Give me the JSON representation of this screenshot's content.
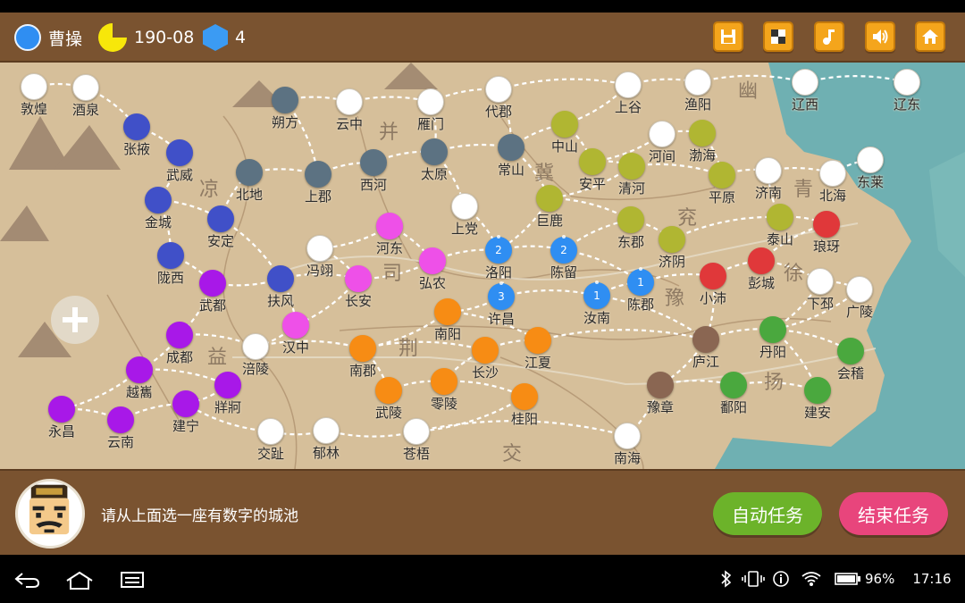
{
  "player": {
    "name": "曹操",
    "date": "190-08",
    "count": "4",
    "color": "#2f8ef2"
  },
  "toolbar": {
    "buttons": [
      {
        "name": "save-button",
        "icon": "floppy-icon"
      },
      {
        "name": "checker-button",
        "icon": "checkerboard-icon"
      },
      {
        "name": "music-button",
        "icon": "music-note-icon"
      },
      {
        "name": "sound-button",
        "icon": "speaker-icon"
      },
      {
        "name": "home-button",
        "icon": "home-icon"
      }
    ]
  },
  "regions": [
    "幽",
    "并",
    "冀",
    "青",
    "凉",
    "兖",
    "司",
    "徐",
    "豫",
    "益",
    "荆",
    "扬",
    "交"
  ],
  "cities": [
    {
      "name": "敦煌",
      "color": "#ffffff",
      "num": ""
    },
    {
      "name": "酒泉",
      "color": "#ffffff",
      "num": ""
    },
    {
      "name": "张掖",
      "color": "#4050c8",
      "num": ""
    },
    {
      "name": "武威",
      "color": "#4050c8",
      "num": ""
    },
    {
      "name": "金城",
      "color": "#4050c8",
      "num": ""
    },
    {
      "name": "安定",
      "color": "#4050c8",
      "num": ""
    },
    {
      "name": "陇西",
      "color": "#4050c8",
      "num": ""
    },
    {
      "name": "北地",
      "color": "#5c7282",
      "num": ""
    },
    {
      "name": "朔方",
      "color": "#5c7282",
      "num": ""
    },
    {
      "name": "云中",
      "color": "#ffffff",
      "num": ""
    },
    {
      "name": "雁门",
      "color": "#ffffff",
      "num": ""
    },
    {
      "name": "代郡",
      "color": "#ffffff",
      "num": ""
    },
    {
      "name": "上谷",
      "color": "#ffffff",
      "num": ""
    },
    {
      "name": "渔阳",
      "color": "#ffffff",
      "num": ""
    },
    {
      "name": "辽西",
      "color": "#ffffff",
      "num": ""
    },
    {
      "name": "辽东",
      "color": "#ffffff",
      "num": ""
    },
    {
      "name": "上郡",
      "color": "#5c7282",
      "num": ""
    },
    {
      "name": "西河",
      "color": "#5c7282",
      "num": ""
    },
    {
      "name": "太原",
      "color": "#5c7282",
      "num": ""
    },
    {
      "name": "常山",
      "color": "#5c7282",
      "num": ""
    },
    {
      "name": "中山",
      "color": "#b0b632",
      "num": ""
    },
    {
      "name": "河间",
      "color": "#ffffff",
      "num": ""
    },
    {
      "name": "渤海",
      "color": "#b0b632",
      "num": ""
    },
    {
      "name": "安平",
      "color": "#b0b632",
      "num": ""
    },
    {
      "name": "清河",
      "color": "#b0b632",
      "num": ""
    },
    {
      "name": "平原",
      "color": "#b0b632",
      "num": ""
    },
    {
      "name": "济南",
      "color": "#ffffff",
      "num": ""
    },
    {
      "name": "北海",
      "color": "#ffffff",
      "num": ""
    },
    {
      "name": "东莱",
      "color": "#ffffff",
      "num": ""
    },
    {
      "name": "巨鹿",
      "color": "#b0b632",
      "num": ""
    },
    {
      "name": "上党",
      "color": "#ffffff",
      "num": ""
    },
    {
      "name": "东郡",
      "color": "#b0b632",
      "num": ""
    },
    {
      "name": "济阴",
      "color": "#b0b632",
      "num": ""
    },
    {
      "name": "泰山",
      "color": "#b0b632",
      "num": ""
    },
    {
      "name": "琅玡",
      "color": "#e0383a",
      "num": ""
    },
    {
      "name": "河东",
      "color": "#ee50e8",
      "num": ""
    },
    {
      "name": "冯翊",
      "color": "#ffffff",
      "num": ""
    },
    {
      "name": "弘农",
      "color": "#ee50e8",
      "num": ""
    },
    {
      "name": "洛阳",
      "color": "#2f8ef2",
      "num": "2"
    },
    {
      "name": "陈留",
      "color": "#2f8ef2",
      "num": "2"
    },
    {
      "name": "扶风",
      "color": "#4050c8",
      "num": ""
    },
    {
      "name": "长安",
      "color": "#ee50e8",
      "num": ""
    },
    {
      "name": "许昌",
      "color": "#2f8ef2",
      "num": "3"
    },
    {
      "name": "汝南",
      "color": "#2f8ef2",
      "num": "1"
    },
    {
      "name": "陈郡",
      "color": "#2f8ef2",
      "num": "1"
    },
    {
      "name": "小沛",
      "color": "#e0383a",
      "num": ""
    },
    {
      "name": "彭城",
      "color": "#e0383a",
      "num": ""
    },
    {
      "name": "下邳",
      "color": "#ffffff",
      "num": ""
    },
    {
      "name": "广陵",
      "color": "#ffffff",
      "num": ""
    },
    {
      "name": "武都",
      "color": "#a818e8",
      "num": ""
    },
    {
      "name": "汉中",
      "color": "#ee50e8",
      "num": ""
    },
    {
      "name": "南阳",
      "color": "#f78c14",
      "num": ""
    },
    {
      "name": "成都",
      "color": "#a818e8",
      "num": ""
    },
    {
      "name": "涪陵",
      "color": "#ffffff",
      "num": ""
    },
    {
      "name": "南郡",
      "color": "#f78c14",
      "num": ""
    },
    {
      "name": "长沙",
      "color": "#f78c14",
      "num": ""
    },
    {
      "name": "江夏",
      "color": "#f78c14",
      "num": ""
    },
    {
      "name": "庐江",
      "color": "#8a6652",
      "num": ""
    },
    {
      "name": "丹阳",
      "color": "#4aa83e",
      "num": ""
    },
    {
      "name": "会稽",
      "color": "#4aa83e",
      "num": ""
    },
    {
      "name": "越巂",
      "color": "#a818e8",
      "num": ""
    },
    {
      "name": "牂牁",
      "color": "#a818e8",
      "num": ""
    },
    {
      "name": "永昌",
      "color": "#a818e8",
      "num": ""
    },
    {
      "name": "建宁",
      "color": "#a818e8",
      "num": ""
    },
    {
      "name": "云南",
      "color": "#a818e8",
      "num": ""
    },
    {
      "name": "武陵",
      "color": "#f78c14",
      "num": ""
    },
    {
      "name": "零陵",
      "color": "#f78c14",
      "num": ""
    },
    {
      "name": "桂阳",
      "color": "#f78c14",
      "num": ""
    },
    {
      "name": "豫章",
      "color": "#8a6652",
      "num": ""
    },
    {
      "name": "鄱阳",
      "color": "#4aa83e",
      "num": ""
    },
    {
      "name": "建安",
      "color": "#4aa83e",
      "num": ""
    },
    {
      "name": "交趾",
      "color": "#ffffff",
      "num": ""
    },
    {
      "name": "郁林",
      "color": "#ffffff",
      "num": ""
    },
    {
      "name": "苍梧",
      "color": "#ffffff",
      "num": ""
    },
    {
      "name": "南海",
      "color": "#ffffff",
      "num": ""
    }
  ],
  "bottom": {
    "message": "请从上面选一座有数字的城池",
    "auto_label": "自动任务",
    "end_label": "结束任务"
  },
  "status_bar": {
    "battery": "96%",
    "time": "17:16"
  }
}
